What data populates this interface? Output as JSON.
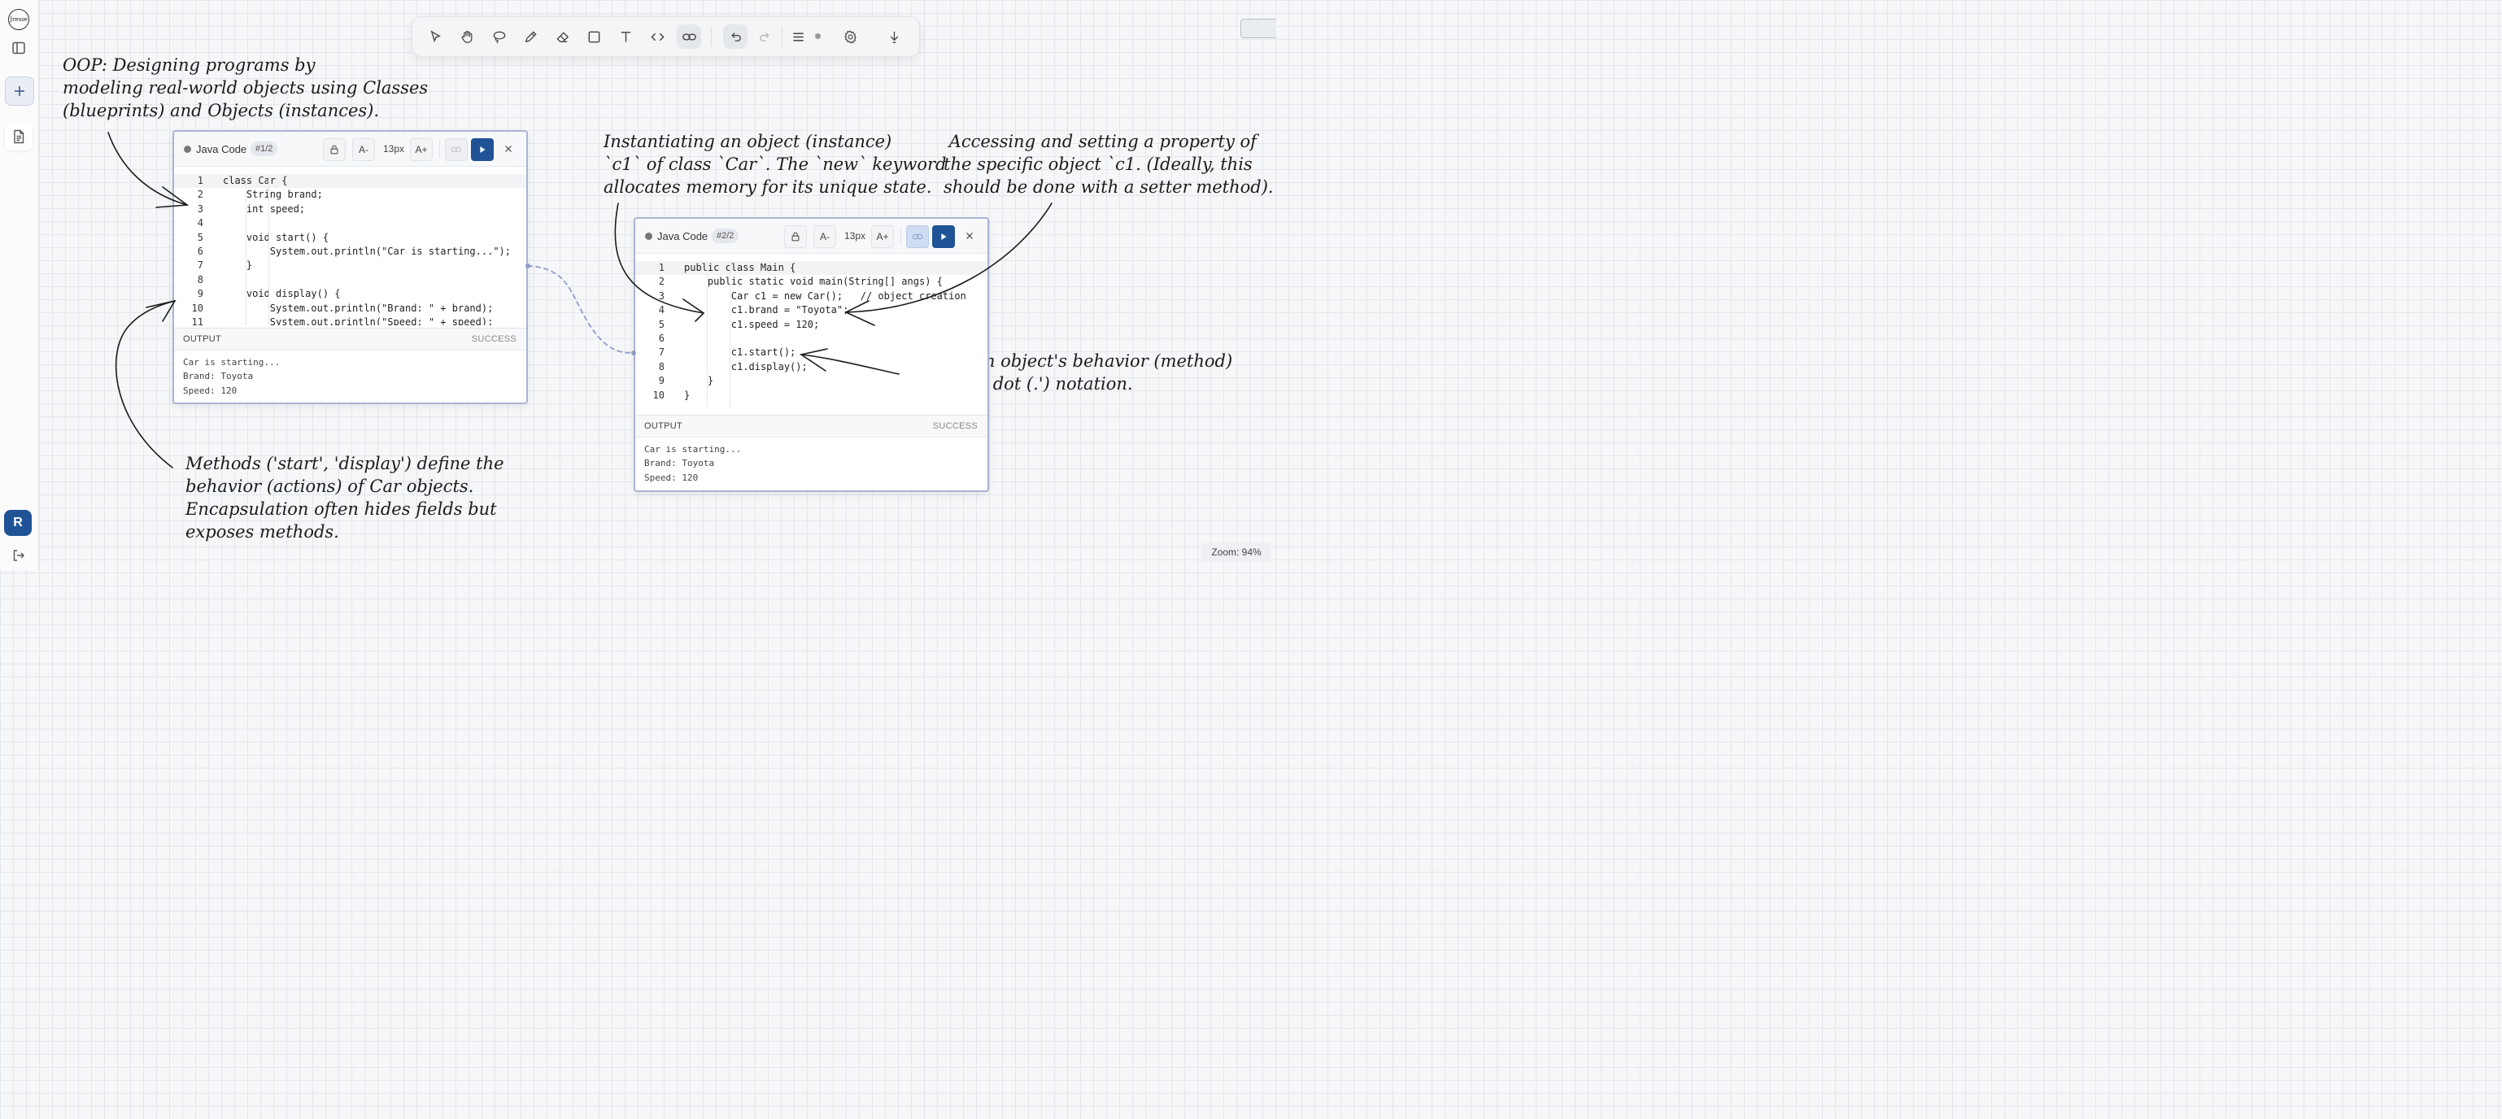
{
  "rail": {
    "logo_text": "Jresse",
    "avatar_initial": "R"
  },
  "toolbar": {
    "tools": [
      "select",
      "hand",
      "lasso",
      "pencil",
      "eraser",
      "rectangle",
      "text",
      "code",
      "link",
      "undo",
      "redo",
      "menu",
      "settings",
      "download"
    ]
  },
  "annotations": {
    "oop": "OOP: Designing programs by\nmodeling real-world objects using Classes\n(blueprints) and Objects (instances).",
    "instantiating": "Instantiating an object (instance)\n`c1` of class `Car`. The `new` keyword\nallocates memory for its unique state.",
    "accessing": " Accessing and setting a property of\nthe specific object `c1. (Ideally, this\nshould be done with a setter method).",
    "calling": "Calling an object's behavior (method)\nusing the dot (.') notation.",
    "methods": "Methods ('start', 'display') define the\nbehavior (actions) of Car objects.\nEncapsulation often hides fields but\nexposes methods."
  },
  "panel1": {
    "title": "Java Code",
    "badge": "#1/2",
    "font_down": "A-",
    "font_size": "13px",
    "font_up": "A+",
    "lines": [
      {
        "n": "1",
        "t": "class Car {"
      },
      {
        "n": "2",
        "t": "    String brand;"
      },
      {
        "n": "3",
        "t": "    int speed;"
      },
      {
        "n": "4",
        "t": ""
      },
      {
        "n": "5",
        "t": "    void start() {"
      },
      {
        "n": "6",
        "t": "        System.out.println(\"Car is starting...\");"
      },
      {
        "n": "7",
        "t": "    }"
      },
      {
        "n": "8",
        "t": ""
      },
      {
        "n": "9",
        "t": "    void display() {"
      },
      {
        "n": "10",
        "t": "        System.out.println(\"Brand: \" + brand);"
      },
      {
        "n": "11",
        "t": "        System.out.println(\"Speed: \" + speed);"
      }
    ],
    "output_label": "OUTPUT",
    "output_status": "SUCCESS",
    "output": "Car is starting...\nBrand: Toyota\nSpeed: 120"
  },
  "panel2": {
    "title": "Java Code",
    "badge": "#2/2",
    "font_down": "A-",
    "font_size": "13px",
    "font_up": "A+",
    "lines": [
      {
        "n": "1",
        "t": "public class Main {"
      },
      {
        "n": "2",
        "t": "    public static void main(String[] angs) {"
      },
      {
        "n": "3",
        "t": "        Car c1 = new Car();   // object creation"
      },
      {
        "n": "4",
        "t": "        c1.brand = \"Toyota\";"
      },
      {
        "n": "5",
        "t": "        c1.speed = 120;"
      },
      {
        "n": "6",
        "t": ""
      },
      {
        "n": "7",
        "t": "        c1.start();"
      },
      {
        "n": "8",
        "t": "        c1.display();"
      },
      {
        "n": "9",
        "t": "    }"
      },
      {
        "n": "10",
        "t": "}"
      }
    ],
    "output_label": "OUTPUT",
    "output_status": "SUCCESS",
    "output": "Car is starting...\nBrand: Toyota\nSpeed: 120"
  },
  "zoom": {
    "label": "Zoom:  94%"
  }
}
